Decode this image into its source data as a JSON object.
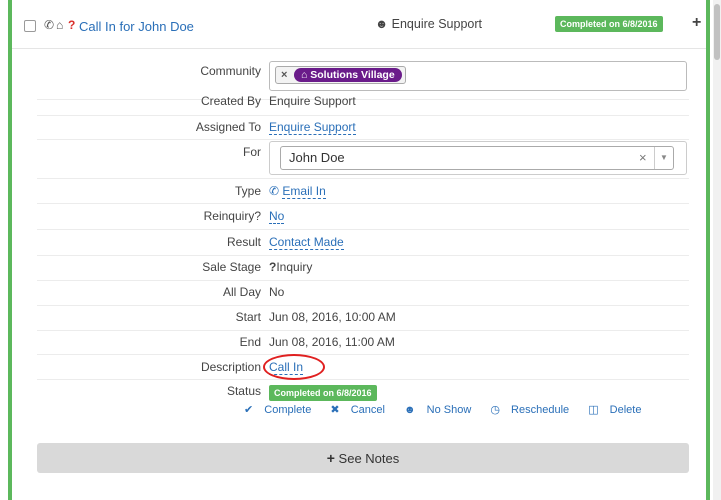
{
  "header": {
    "title_prefix": "Call In for",
    "title_name": "John Doe",
    "owner": "Enquire Support",
    "badge": "Completed on 6/8/2016",
    "icons": [
      "phone-icon",
      "home-icon",
      "question-icon"
    ]
  },
  "fields": {
    "community_label": "Community",
    "community_tag": "Solutions Village",
    "created_by_label": "Created By",
    "created_by": "Enquire Support",
    "assigned_to_label": "Assigned To",
    "assigned_to": "Enquire Support",
    "for_label": "For",
    "for_value": "John Doe",
    "type_label": "Type",
    "type_value": "Email In",
    "reinquiry_label": "Reinquiry?",
    "reinquiry_value": "No",
    "result_label": "Result",
    "result_value": "Contact Made",
    "sale_stage_label": "Sale Stage",
    "sale_stage_value": "Inquiry",
    "all_day_label": "All Day",
    "all_day_value": "No",
    "start_label": "Start",
    "start_value": "Jun 08, 2016, 10:00 AM",
    "end_label": "End",
    "end_value": "Jun 08, 2016, 11:00 AM",
    "description_label": "Description",
    "description_value": "Call In",
    "status_label": "Status",
    "status_badge": "Completed on 6/8/2016"
  },
  "actions": {
    "complete": "Complete",
    "cancel": "Cancel",
    "no_show": "No Show",
    "reschedule": "Reschedule",
    "delete": "Delete"
  },
  "notes_button": "See Notes",
  "colors": {
    "accent_green": "#5cb85c",
    "link_blue": "#2a6fb8",
    "tag_purple": "#6a1b8a",
    "highlight_red": "#e02020"
  }
}
